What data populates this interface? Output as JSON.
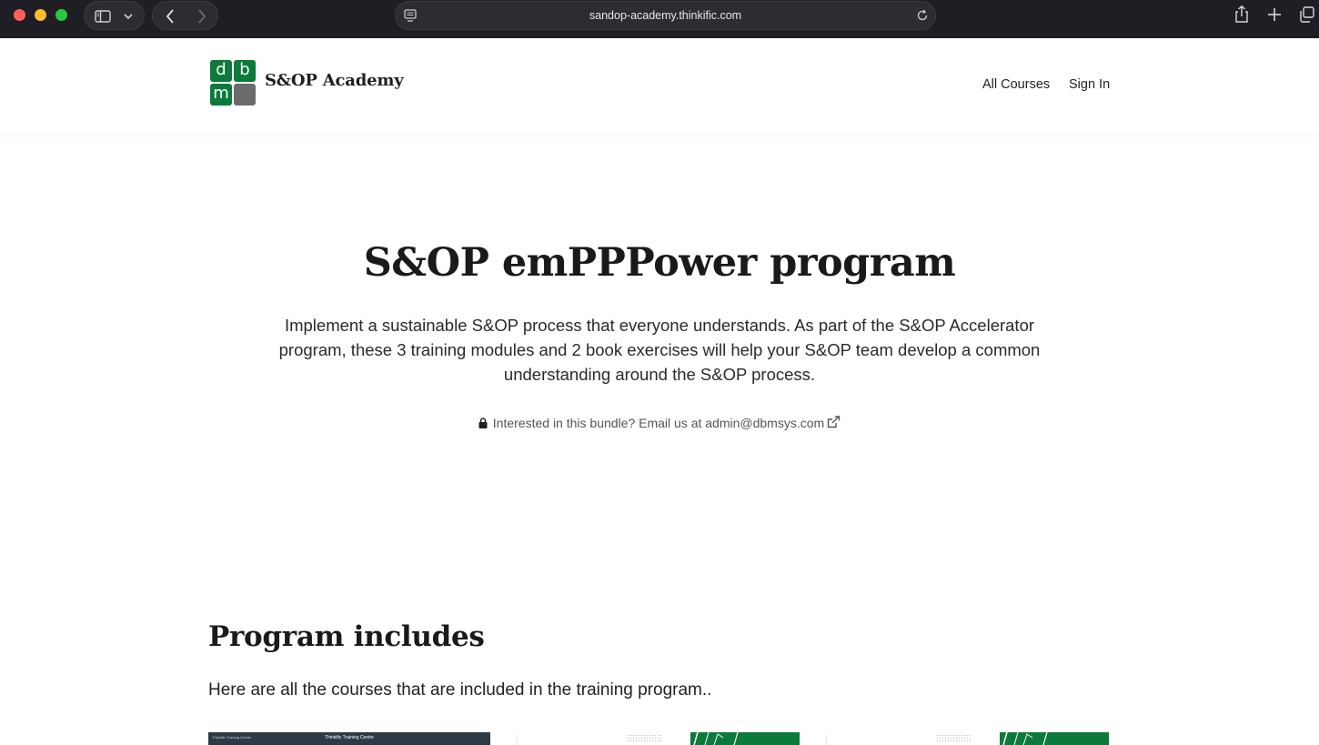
{
  "browser": {
    "url": "sandop-academy.thinkific.com"
  },
  "header": {
    "logo_letters": [
      "d",
      "b",
      "m"
    ],
    "brand": "S&OP Academy",
    "nav": [
      {
        "label": "All Courses"
      },
      {
        "label": "Sign In"
      }
    ]
  },
  "hero": {
    "title": "S&OP emPPPower program",
    "description": "Implement a sustainable S&OP process that everyone understands. As part of the S&OP Accelerator program, these 3 training modules and 2 book exercises will help your S&OP team develop a common understanding around the S&OP process.",
    "bundle_note": "Interested in this bundle? Email us at admin@dbmsys.com"
  },
  "program": {
    "title": "Program includes",
    "subtitle": "Here are all the courses that are included in the training program..",
    "cards": [
      {
        "header_left": "Thinkific Training Center",
        "header_center": "Thinkific Training Centre"
      },
      {},
      {}
    ]
  },
  "colors": {
    "brand_green": "#0b7a3b",
    "logo_gray": "#6b6b6b",
    "chrome_bg": "#1e1e24"
  }
}
